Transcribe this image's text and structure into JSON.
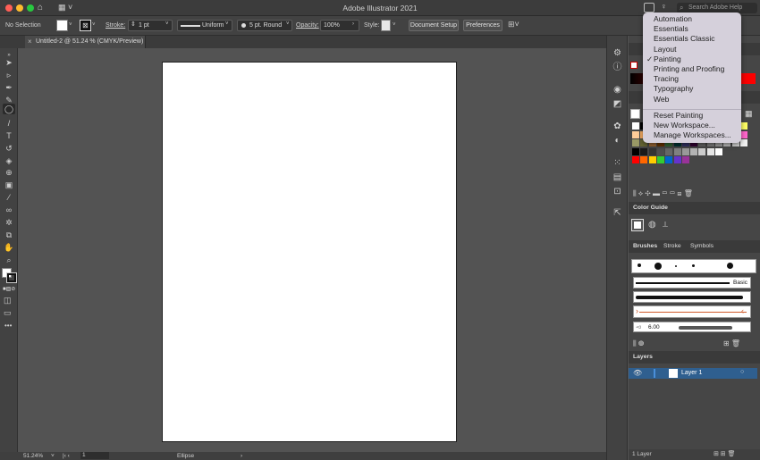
{
  "titlebar": {
    "app_title": "Adobe Illustrator 2021",
    "search_placeholder": "Search Adobe Help",
    "colors": {
      "close": "#ff5f57",
      "minimize": "#febc2e",
      "zoom": "#28c840"
    }
  },
  "controlbar": {
    "selection_label": "No Selection",
    "stroke_label": "Stroke:",
    "stroke_value": "1 pt",
    "stroke_profile": "Uniform",
    "brush_value": "5 pt. Round",
    "opacity_label": "Opacity:",
    "opacity_value": "100%",
    "style_label": "Style:",
    "document_setup_label": "Document Setup",
    "preferences_label": "Preferences"
  },
  "document": {
    "tab_title": "Untitled-2 @ 51.24 % (CMYK/Preview)"
  },
  "statusbar": {
    "zoom": "51.24%",
    "artboard_number": "1",
    "tool_name": "Ellipse"
  },
  "workspace_menu": {
    "items": [
      "Automation",
      "Essentials",
      "Essentials Classic",
      "Layout",
      "Painting",
      "Printing and Proofing",
      "Tracing",
      "Typography",
      "Web"
    ],
    "checked": "Painting",
    "actions": [
      "Reset Painting",
      "New Workspace...",
      "Manage Workspaces..."
    ]
  },
  "panels": {
    "color_guide_title": "Color Guide",
    "brushes_tabs": [
      "Brushes",
      "Stroke",
      "Symbols"
    ],
    "brush_library_label": "Basic",
    "brush_size_value": "6.00",
    "layers_title": "Layers",
    "layer_name": "Layer 1",
    "layers_count": "1 Layer"
  },
  "accent_colors": {
    "selection_blue": "#2f5f8f",
    "layer_color": "#4a8fd9"
  }
}
